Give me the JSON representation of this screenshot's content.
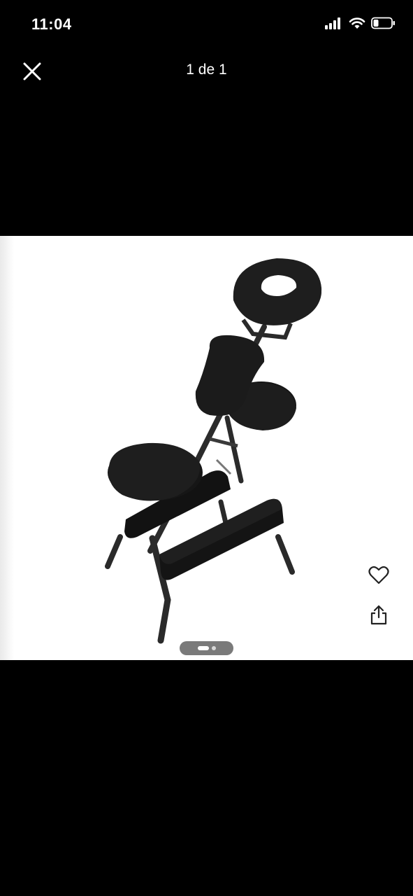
{
  "status_bar": {
    "time": "11:04",
    "icons": [
      "signal-icon",
      "wifi-icon",
      "battery-icon"
    ],
    "battery_level": 0.25
  },
  "viewer": {
    "page_counter": "1 de 1",
    "close_icon": "close-icon",
    "like_icon": "heart-icon",
    "share_icon": "share-icon",
    "pager": {
      "pages": 2,
      "current": 1
    }
  },
  "photo": {
    "subject": "massage-chair-image",
    "background": "#ffffff"
  }
}
